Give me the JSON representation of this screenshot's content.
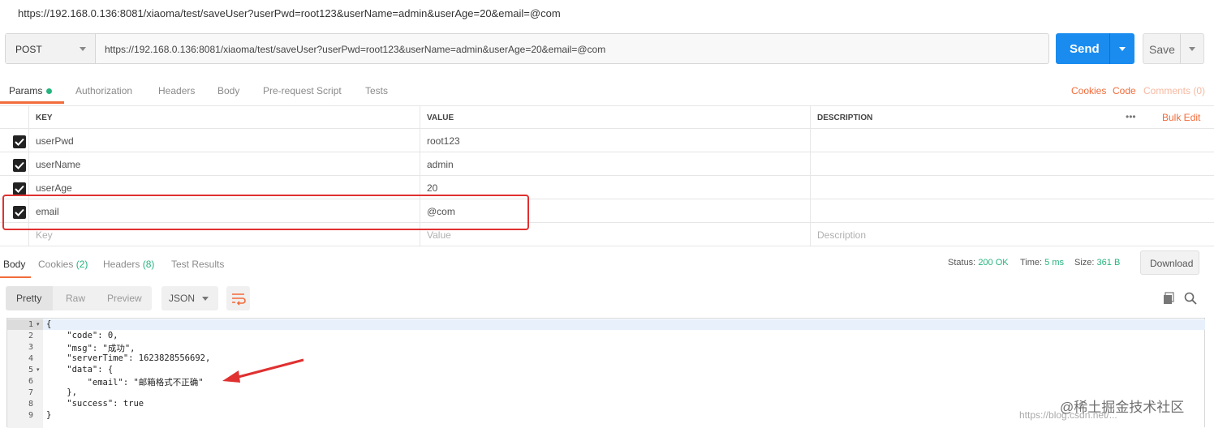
{
  "title_url": "https://192.168.0.136:8081/xiaoma/test/saveUser?userPwd=root123&userName=admin&userAge=20&email=@com",
  "request": {
    "method": "POST",
    "url": "https://192.168.0.136:8081/xiaoma/test/saveUser?userPwd=root123&userName=admin&userAge=20&email=@com",
    "send_label": "Send",
    "save_label": "Save"
  },
  "tabs": {
    "params": "Params",
    "authorization": "Authorization",
    "headers": "Headers",
    "body": "Body",
    "prerequest": "Pre-request Script",
    "tests": "Tests",
    "cookies": "Cookies",
    "code": "Code",
    "comments": "Comments (0)"
  },
  "params_table": {
    "headers": [
      "KEY",
      "VALUE",
      "DESCRIPTION"
    ],
    "bulk_edit": "Bulk Edit",
    "more": "•••",
    "rows": [
      {
        "key": "userPwd",
        "value": "root123",
        "checked": true
      },
      {
        "key": "userName",
        "value": "admin",
        "checked": true
      },
      {
        "key": "userAge",
        "value": "20",
        "checked": true
      },
      {
        "key": "email",
        "value": "@com",
        "checked": true
      }
    ],
    "placeholder": {
      "key": "Key",
      "value": "Value",
      "description": "Description"
    }
  },
  "response_tabs": {
    "body": "Body",
    "cookies": "Cookies",
    "cookies_count": "(2)",
    "headers": "Headers",
    "headers_count": "(8)",
    "test_results": "Test Results"
  },
  "status": {
    "status_label": "Status:",
    "status_value": "200 OK",
    "time_label": "Time:",
    "time_value": "5 ms",
    "size_label": "Size:",
    "size_value": "361 B",
    "download": "Download"
  },
  "format": {
    "pretty": "Pretty",
    "raw": "Raw",
    "preview": "Preview",
    "json": "JSON"
  },
  "code_lines": [
    {
      "n": "1",
      "fold": "▾",
      "text": "{"
    },
    {
      "n": "2",
      "fold": "",
      "text": "    \"code\": 0,"
    },
    {
      "n": "3",
      "fold": "",
      "text": "    \"msg\": \"成功\","
    },
    {
      "n": "4",
      "fold": "",
      "text": "    \"serverTime\": 1623828556692,"
    },
    {
      "n": "5",
      "fold": "▾",
      "text": "    \"data\": {"
    },
    {
      "n": "6",
      "fold": "",
      "text": "        \"email\": \"邮箱格式不正确\""
    },
    {
      "n": "7",
      "fold": "",
      "text": "    },"
    },
    {
      "n": "8",
      "fold": "",
      "text": "    \"success\": true"
    },
    {
      "n": "9",
      "fold": "",
      "text": "}"
    }
  ],
  "watermark": "@稀土掘金技术社区",
  "watermark2": "https://blog.csdn.net/...",
  "colors": {
    "accent": "#f26b3a",
    "send": "#1a8cf0",
    "success": "#26b47f",
    "annotation": "#e03030"
  }
}
